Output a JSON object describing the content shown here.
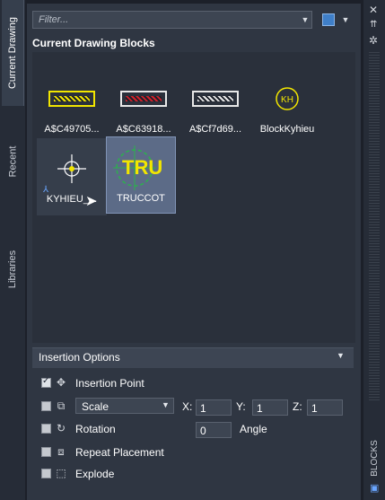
{
  "tabs": [
    {
      "label": "Current Drawing",
      "active": true
    },
    {
      "label": "Recent",
      "active": false
    },
    {
      "label": "Libraries",
      "active": false
    }
  ],
  "filter": {
    "placeholder": "Filter..."
  },
  "section_title": "Current Drawing Blocks",
  "blocks": [
    {
      "name": "A$C49705...",
      "thumb": "yellow-graffiti"
    },
    {
      "name": "A$C63918...",
      "thumb": "red-graffiti"
    },
    {
      "name": "A$Cf7d69...",
      "thumb": "white-graffiti"
    },
    {
      "name": "BlockKyhieu",
      "thumb": "kh-circle",
      "thumb_text": "KH"
    },
    {
      "name": "KYHIEU_...",
      "thumb": "crosshair"
    },
    {
      "name": "TRUCCOT",
      "thumb": "tru-circle",
      "thumb_text": "TRU",
      "selected": true
    }
  ],
  "insertion_options": {
    "title": "Insertion Options",
    "insertion_point": {
      "label": "Insertion Point",
      "checked": true
    },
    "scale": {
      "select_value": "Scale",
      "x_label": "X:",
      "x": "1",
      "y_label": "Y:",
      "y": "1",
      "z_label": "Z:",
      "z": "1"
    },
    "rotation": {
      "label": "Rotation",
      "value": "0",
      "angle_label": "Angle"
    },
    "repeat_placement": {
      "label": "Repeat Placement"
    },
    "explode": {
      "label": "Explode"
    }
  },
  "palette_label": "BLOCKS",
  "colors": {
    "accent_yellow": "#f2e600",
    "accent_green": "#2bb24c",
    "selected_tile": "#5c6b87"
  }
}
